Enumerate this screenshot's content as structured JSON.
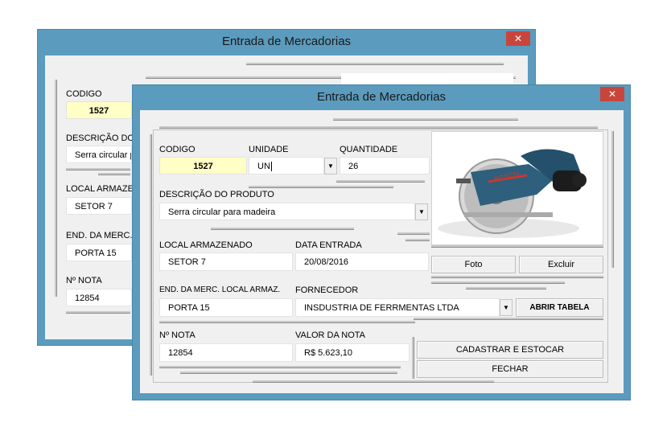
{
  "back_window": {
    "title": "Entrada de Mercadorias",
    "close_glyph": "✕",
    "codigo_label": "CODIGO",
    "codigo_value": "1527",
    "descricao_label": "DESCRIÇÃO DO",
    "descricao_value": "Serra circular p",
    "local_label": "LOCAL ARMAZEN",
    "local_value": "SETOR 7",
    "end_label": "END. DA MERC. L",
    "end_value": "PORTA 15",
    "nota_label": "Nº NOTA",
    "nota_value": "12854"
  },
  "front_window": {
    "title": "Entrada de Mercadorias",
    "close_glyph": "✕",
    "codigo_label": "CODIGO",
    "codigo_value": "1527",
    "unidade_label": "UNIDADE",
    "unidade_value": "UN",
    "quantidade_label": "QUANTIDADE",
    "quantidade_value": "26",
    "descricao_label": "DESCRIÇÃO DO PRODUTO",
    "descricao_value": "Serra circular para madeira",
    "local_label": "LOCAL ARMAZENADO",
    "local_value": "SETOR 7",
    "data_label": "DATA ENTRADA",
    "data_value": "20/08/2016",
    "foto_button": "Foto",
    "excluir_button": "Excluir",
    "end_label": "END. DA MERC. LOCAL ARMAZ.",
    "end_value": "PORTA 15",
    "fornecedor_label": "FORNECEDOR",
    "fornecedor_value": "INSDUSTRIA DE FERRMENTAS LTDA",
    "abrir_tabela_button": "ABRIR TABELA",
    "nota_label": "Nº NOTA",
    "nota_value": "12854",
    "valor_label": "VALOR DA NOTA",
    "valor_value": "R$ 5.623,10",
    "cadastrar_button": "CADASTRAR E ESTOCAR",
    "fechar_button": "FECHAR",
    "photo_brand": "BOSCH",
    "dropdown_glyph": "▼"
  },
  "colors": {
    "window_frame": "#5b9bbd",
    "close_button": "#c9453c",
    "client_bg": "#f0f0f0",
    "codigo_field": "#ffffc6"
  }
}
